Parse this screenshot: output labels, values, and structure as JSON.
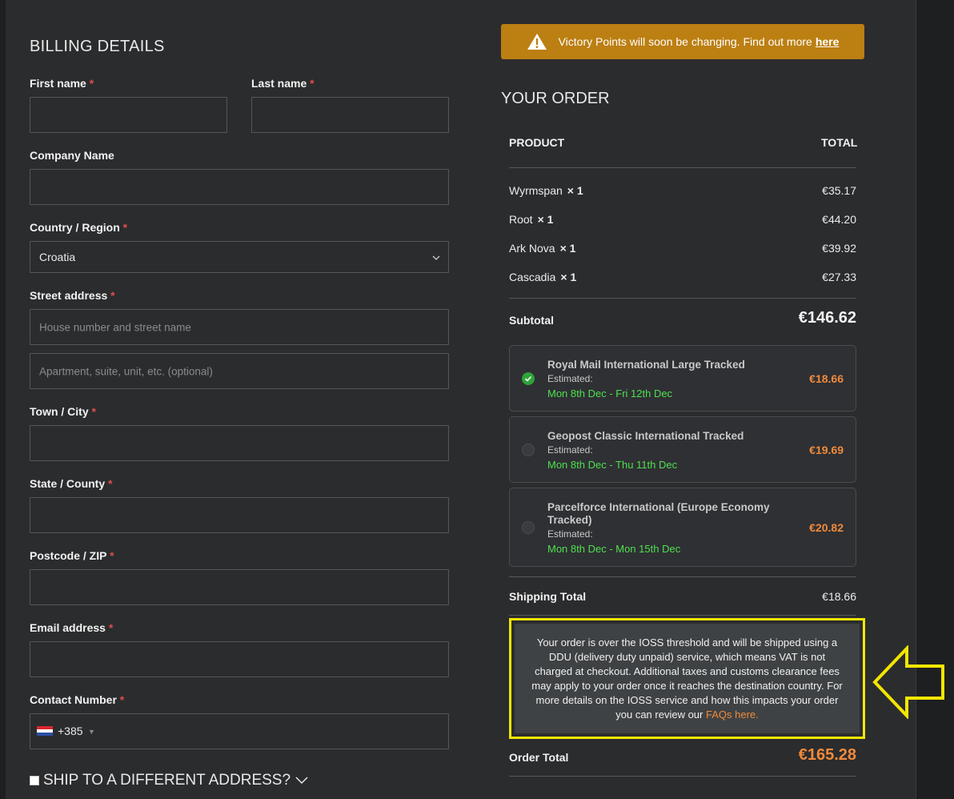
{
  "billing": {
    "title": "BILLING DETAILS",
    "first_name": "First name",
    "last_name": "Last name",
    "company": "Company Name",
    "country_label": "Country / Region",
    "country_value": "Croatia",
    "street_label": "Street address",
    "street_ph1": "House number and street name",
    "street_ph2": "Apartment, suite, unit, etc. (optional)",
    "town": "Town / City",
    "state": "State / County",
    "postcode": "Postcode / ZIP",
    "email": "Email address",
    "contact": "Contact Number",
    "dial_code": "+385",
    "required_mark": "*",
    "ship_different": "SHIP TO A DIFFERENT ADDRESS?"
  },
  "banner": {
    "text": "Victory Points will soon be changing. Find out more",
    "link": "here",
    "color": "#bc7f12"
  },
  "order": {
    "title": "YOUR ORDER",
    "col_product": "PRODUCT",
    "col_total": "TOTAL",
    "items": [
      {
        "name": "Wyrmspan",
        "qty": "× 1",
        "price": "€35.17"
      },
      {
        "name": "Root",
        "qty": "× 1",
        "price": "€44.20"
      },
      {
        "name": "Ark Nova",
        "qty": "× 1",
        "price": "€39.92"
      },
      {
        "name": "Cascadia",
        "qty": "× 1",
        "price": "€27.33"
      }
    ],
    "subtotal_label": "Subtotal",
    "subtotal": "€146.62",
    "shipping": [
      {
        "name": "Royal Mail International Large Tracked",
        "est": "Estimated:",
        "dates": "Mon 8th Dec - Fri 12th Dec",
        "price": "€18.66",
        "selected": true
      },
      {
        "name": "Geopost Classic International Tracked",
        "est": "Estimated:",
        "dates": "Mon 8th Dec - Thu 11th Dec",
        "price": "€19.69",
        "selected": false
      },
      {
        "name": "Parcelforce International (Europe Economy Tracked)",
        "est": "Estimated:",
        "dates": "Mon 8th Dec - Mon 15th Dec",
        "price": "€20.82",
        "selected": false
      }
    ],
    "shipping_total_label": "Shipping Total",
    "shipping_total": "€18.66",
    "notice_text": "Your order is over the IOSS threshold and will be shipped using a DDU (delivery duty unpaid) service, which means VAT is not charged at checkout. Additional taxes and customs clearance fees may apply to your order once it reaches the destination country. For more details on the IOSS service and how this impacts your order you can review our",
    "notice_link": "FAQs here.",
    "order_total_label": "Order Total",
    "order_total": "€165.28",
    "accent_color": "#f08a3a",
    "highlight_color": "#f3e600"
  }
}
